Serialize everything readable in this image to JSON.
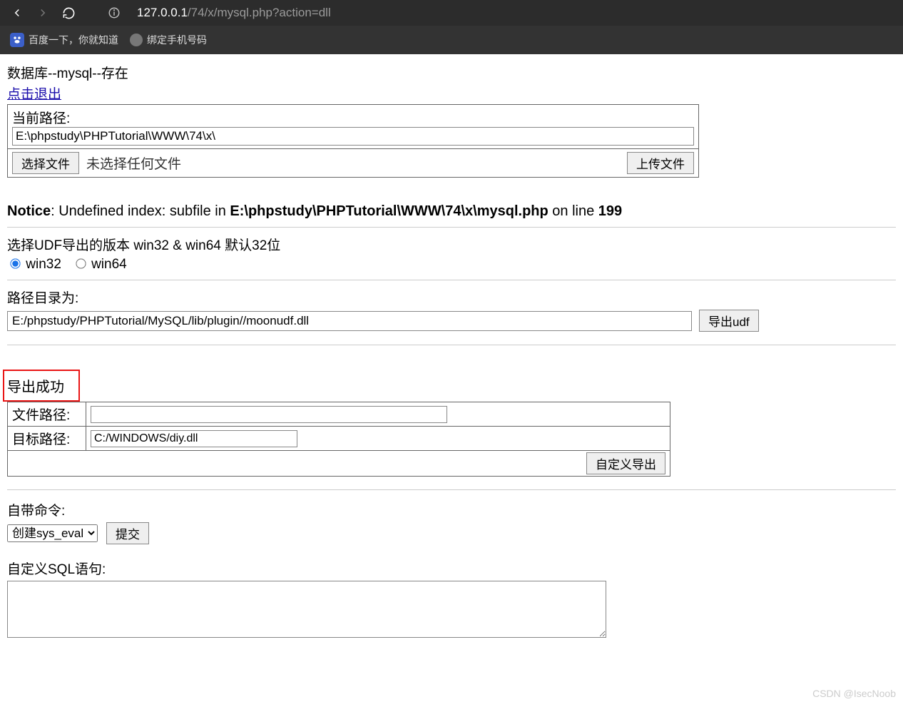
{
  "browser": {
    "url_host": "127.0.0.1",
    "url_path": "/74/x/mysql.php?action=dll",
    "bookmarks": {
      "baidu": "百度一下，你就知道",
      "phone": "绑定手机号码"
    }
  },
  "header": {
    "title": "数据库--mysql--存在",
    "exit_link": "点击退出"
  },
  "upload": {
    "current_path_label": "当前路径:",
    "current_path_value": "E:\\phpstudy\\PHPTutorial\\WWW\\74\\x\\",
    "choose_file_btn": "选择文件",
    "no_file_text": "未选择任何文件",
    "upload_btn": "上传文件"
  },
  "notice": {
    "prefix": "Notice",
    "msg_mid": ": Undefined index: subfile in ",
    "file": "E:\\phpstudy\\PHPTutorial\\WWW\\74\\x\\mysql.php",
    "on_line": " on line ",
    "line_no": "199"
  },
  "udf": {
    "select_label": "选择UDF导出的版本 win32 & win64 默认32位",
    "radio_win32": "win32",
    "radio_win64": "win64"
  },
  "export": {
    "path_label": "路径目录为:",
    "path_value": "E:/phpstudy/PHPTutorial/MySQL/lib/plugin//moonudf.dll",
    "export_btn": "导出udf"
  },
  "status": {
    "success": "导出成功"
  },
  "custom": {
    "file_path_label": "文件路径:",
    "file_path_value": "",
    "target_path_label": "目标路径:",
    "target_path_value": "C:/WINDOWS/diy.dll",
    "submit_btn": "自定义导出"
  },
  "cmd": {
    "label": "自带命令:",
    "select_value": "创建sys_eval",
    "submit": "提交"
  },
  "sql": {
    "label": "自定义SQL语句:"
  },
  "watermark": "CSDN @IsecNoob"
}
